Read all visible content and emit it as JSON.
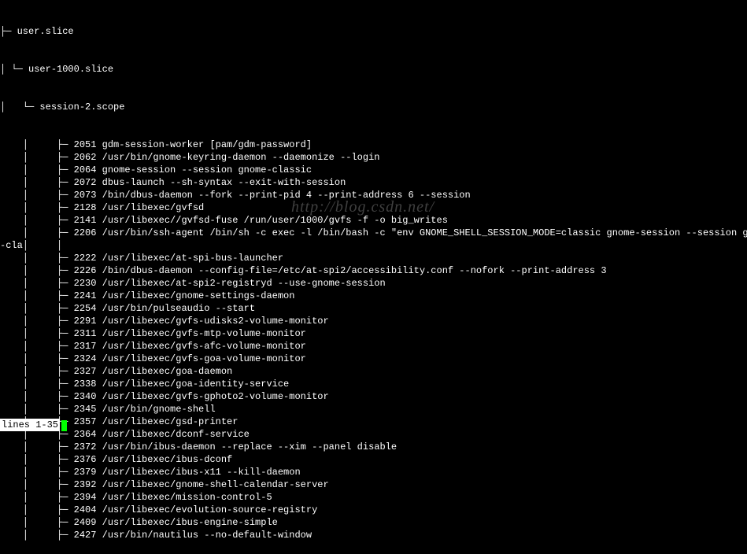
{
  "tree": {
    "root": "user.slice",
    "sub": "user-1000.slice",
    "scope": "session-2.scope",
    "side_label": "-cla",
    "processes": [
      {
        "pid": "2051",
        "cmd": "gdm-session-worker [pam/gdm-password]"
      },
      {
        "pid": "2062",
        "cmd": "/usr/bin/gnome-keyring-daemon --daemonize --login"
      },
      {
        "pid": "2064",
        "cmd": "gnome-session --session gnome-classic"
      },
      {
        "pid": "2072",
        "cmd": "dbus-launch --sh-syntax --exit-with-session"
      },
      {
        "pid": "2073",
        "cmd": "/bin/dbus-daemon --fork --print-pid 4 --print-address 6 --session"
      },
      {
        "pid": "2128",
        "cmd": "/usr/libexec/gvfsd"
      },
      {
        "pid": "2141",
        "cmd": "/usr/libexec//gvfsd-fuse /run/user/1000/gvfs -f -o big_writes"
      },
      {
        "pid": "2206",
        "cmd": "/usr/bin/ssh-agent /bin/sh -c exec -l /bin/bash -c \"env GNOME_SHELL_SESSION_MODE=classic gnome-session --session gnome"
      },
      {
        "pid": "   ",
        "cmd": ""
      },
      {
        "pid": "2222",
        "cmd": "/usr/libexec/at-spi-bus-launcher"
      },
      {
        "pid": "2226",
        "cmd": "/bin/dbus-daemon --config-file=/etc/at-spi2/accessibility.conf --nofork --print-address 3"
      },
      {
        "pid": "2230",
        "cmd": "/usr/libexec/at-spi2-registryd --use-gnome-session"
      },
      {
        "pid": "2241",
        "cmd": "/usr/libexec/gnome-settings-daemon"
      },
      {
        "pid": "2254",
        "cmd": "/usr/bin/pulseaudio --start"
      },
      {
        "pid": "2291",
        "cmd": "/usr/libexec/gvfs-udisks2-volume-monitor"
      },
      {
        "pid": "2311",
        "cmd": "/usr/libexec/gvfs-mtp-volume-monitor"
      },
      {
        "pid": "2317",
        "cmd": "/usr/libexec/gvfs-afc-volume-monitor"
      },
      {
        "pid": "2324",
        "cmd": "/usr/libexec/gvfs-goa-volume-monitor"
      },
      {
        "pid": "2327",
        "cmd": "/usr/libexec/goa-daemon"
      },
      {
        "pid": "2338",
        "cmd": "/usr/libexec/goa-identity-service"
      },
      {
        "pid": "2340",
        "cmd": "/usr/libexec/gvfs-gphoto2-volume-monitor"
      },
      {
        "pid": "2345",
        "cmd": "/usr/bin/gnome-shell"
      },
      {
        "pid": "2357",
        "cmd": "/usr/libexec/gsd-printer"
      },
      {
        "pid": "2364",
        "cmd": "/usr/libexec/dconf-service"
      },
      {
        "pid": "2372",
        "cmd": "/usr/bin/ibus-daemon --replace --xim --panel disable"
      },
      {
        "pid": "2376",
        "cmd": "/usr/libexec/ibus-dconf"
      },
      {
        "pid": "2379",
        "cmd": "/usr/libexec/ibus-x11 --kill-daemon"
      },
      {
        "pid": "2392",
        "cmd": "/usr/libexec/gnome-shell-calendar-server"
      },
      {
        "pid": "2394",
        "cmd": "/usr/libexec/mission-control-5"
      },
      {
        "pid": "2404",
        "cmd": "/usr/libexec/evolution-source-registry"
      },
      {
        "pid": "2409",
        "cmd": "/usr/libexec/ibus-engine-simple"
      },
      {
        "pid": "2427",
        "cmd": "/usr/bin/nautilus --no-default-window"
      }
    ]
  },
  "status": "lines 1-35",
  "watermark": "http://blog.csdn.net/"
}
